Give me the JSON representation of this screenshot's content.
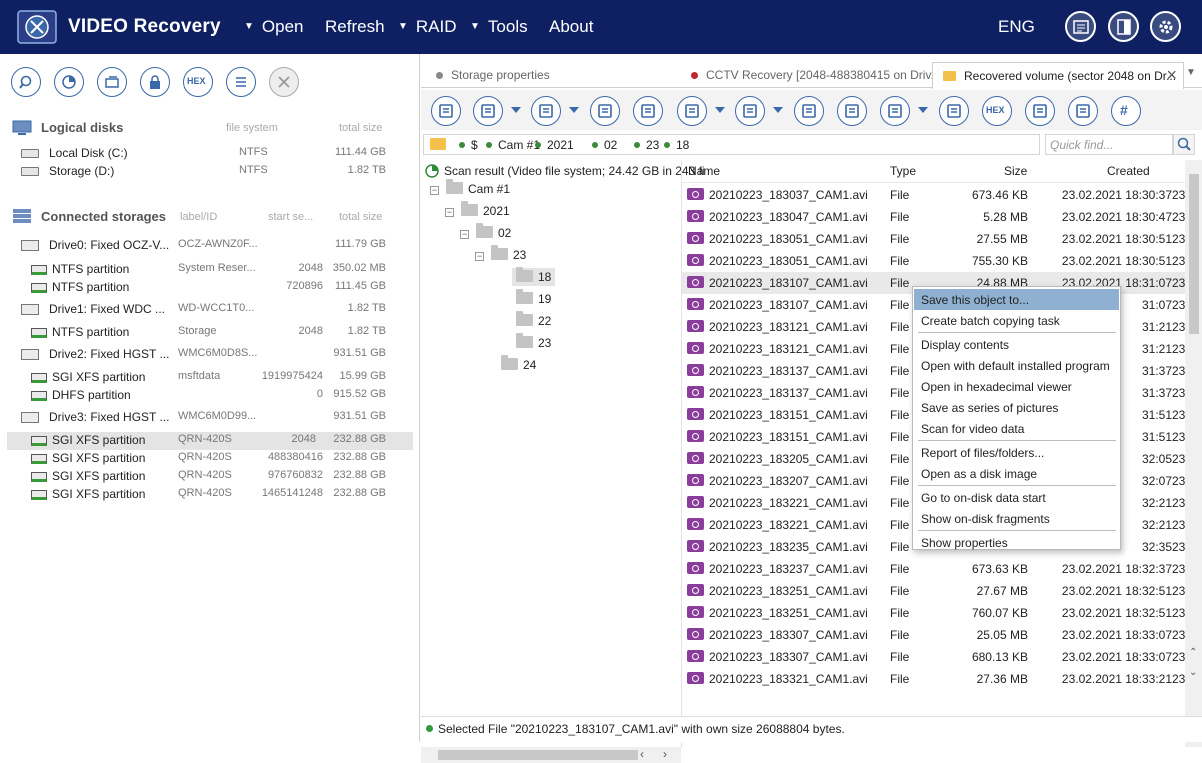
{
  "app": {
    "title": "VIDEO Recovery",
    "menu": [
      {
        "label": "Open",
        "arrow": true
      },
      {
        "label": "Refresh",
        "arrow": false
      },
      {
        "label": "RAID",
        "arrow": true
      },
      {
        "label": "Tools",
        "arrow": true
      },
      {
        "label": "About",
        "arrow": false
      }
    ],
    "arrow_glyph": "▼",
    "lang": "ENG",
    "header_icons": [
      "log-icon",
      "panel-toggle-icon",
      "settings-gear-icon"
    ]
  },
  "left_toolbar": [
    "search-icon",
    "scan-icon",
    "open-image-icon",
    "lock-icon",
    "hex-icon",
    "list-icon",
    "close-icon"
  ],
  "hex_label": "HEX",
  "logical": {
    "title": "Logical disks",
    "col_fs": "file system",
    "col_size": "total size",
    "items": [
      {
        "name": "Local Disk (C:)",
        "fs": "NTFS",
        "size": "111.44 GB"
      },
      {
        "name": "Storage (D:)",
        "fs": "NTFS",
        "size": "1.82 TB"
      }
    ]
  },
  "storages": {
    "title": "Connected storages",
    "col_label": "label/ID",
    "col_start": "start se...",
    "col_size": "total size",
    "items": [
      {
        "level": 0,
        "name": "Drive0: Fixed OCZ-V...",
        "label": "OCZ-AWNZ0F...",
        "start": "",
        "size": "111.79 GB",
        "selected": false
      },
      {
        "level": 1,
        "name": "NTFS partition",
        "label": "System Reser...",
        "start": "2048",
        "size": "350.02 MB",
        "selected": false
      },
      {
        "level": 1,
        "name": "NTFS partition",
        "label": "",
        "start": "720896",
        "size": "111.45 GB",
        "selected": false
      },
      {
        "level": 0,
        "name": "Drive1: Fixed WDC ...",
        "label": "WD-WCC1T0...",
        "start": "",
        "size": "1.82 TB",
        "selected": false
      },
      {
        "level": 1,
        "name": "NTFS partition",
        "label": "Storage",
        "start": "2048",
        "size": "1.82 TB",
        "selected": false
      },
      {
        "level": 0,
        "name": "Drive2: Fixed HGST ...",
        "label": "WMC6M0D8S...",
        "start": "",
        "size": "931.51 GB",
        "selected": false
      },
      {
        "level": 1,
        "name": "SGI XFS partition",
        "label": "msftdata",
        "start": "1919975424",
        "size": "15.99 GB",
        "selected": false
      },
      {
        "level": 1,
        "name": "DHFS partition",
        "label": "",
        "start": "0",
        "size": "915.52 GB",
        "selected": false
      },
      {
        "level": 0,
        "name": "Drive3: Fixed HGST ...",
        "label": "WMC6M0D99...",
        "start": "",
        "size": "931.51 GB",
        "selected": false
      },
      {
        "level": 1,
        "name": "SGI XFS partition",
        "label": "QRN-420S",
        "start": "2048",
        "size": "232.88 GB",
        "selected": true
      },
      {
        "level": 1,
        "name": "SGI XFS partition",
        "label": "QRN-420S",
        "start": "488380416",
        "size": "232.88 GB",
        "selected": false
      },
      {
        "level": 1,
        "name": "SGI XFS partition",
        "label": "QRN-420S",
        "start": "976760832",
        "size": "232.88 GB",
        "selected": false
      },
      {
        "level": 1,
        "name": "SGI XFS partition",
        "label": "QRN-420S",
        "start": "1465141248",
        "size": "232.88 GB",
        "selected": false
      }
    ]
  },
  "tabs": [
    {
      "label": "Storage properties",
      "dot": "#888888",
      "active": false
    },
    {
      "label": "CCTV Recovery [2048-488380415 on Driv...",
      "dot": "#c0262d",
      "active": false
    },
    {
      "label": "Recovered volume (sector 2048 on Dr...",
      "dot": "",
      "active": true
    }
  ],
  "tab_close": "×",
  "path": [
    "$",
    "Cam #1",
    "2021",
    "02",
    "23",
    "18"
  ],
  "quick_find": "Quick find...",
  "tree": {
    "root": "Scan result (Video file system; 24.42 GB in 243 fi",
    "nodes": [
      {
        "label": "Cam #1",
        "exp": "−"
      },
      {
        "label": "2021",
        "exp": "−"
      },
      {
        "label": "02",
        "exp": "−"
      },
      {
        "label": "23",
        "exp": "−"
      },
      {
        "label": "18",
        "exp": ""
      },
      {
        "label": "19",
        "exp": ""
      },
      {
        "label": "22",
        "exp": ""
      },
      {
        "label": "23",
        "exp": ""
      },
      {
        "label": "24",
        "exp": ""
      }
    ]
  },
  "files": {
    "cols": {
      "name": "Name",
      "type": "Type",
      "size": "Size",
      "created": "Created"
    },
    "rows": [
      {
        "name": "20210223_183037_CAM1.avi",
        "type": "File",
        "size": "673.46 KB",
        "created": "23.02.2021 18:30:37",
        "more": "23"
      },
      {
        "name": "20210223_183047_CAM1.avi",
        "type": "File",
        "size": "5.28 MB",
        "created": "23.02.2021 18:30:47",
        "more": "23"
      },
      {
        "name": "20210223_183051_CAM1.avi",
        "type": "File",
        "size": "27.55 MB",
        "created": "23.02.2021 18:30:51",
        "more": "23"
      },
      {
        "name": "20210223_183051_CAM1.avi",
        "type": "File",
        "size": "755.30 KB",
        "created": "23.02.2021 18:30:51",
        "more": "23"
      },
      {
        "name": "20210223_183107_CAM1.avi",
        "type": "File",
        "size": "24.88 MB",
        "created": "23.02.2021 18:31:07",
        "more": "23"
      },
      {
        "name": "20210223_183107_CAM1.avi",
        "type": "File",
        "size": "",
        "created": "31:07",
        "more": "23"
      },
      {
        "name": "20210223_183121_CAM1.avi",
        "type": "File",
        "size": "",
        "created": "31:21",
        "more": "23"
      },
      {
        "name": "20210223_183121_CAM1.avi",
        "type": "File",
        "size": "",
        "created": "31:21",
        "more": "23"
      },
      {
        "name": "20210223_183137_CAM1.avi",
        "type": "File",
        "size": "",
        "created": "31:37",
        "more": "23"
      },
      {
        "name": "20210223_183137_CAM1.avi",
        "type": "File",
        "size": "",
        "created": "31:37",
        "more": "23"
      },
      {
        "name": "20210223_183151_CAM1.avi",
        "type": "File",
        "size": "",
        "created": "31:51",
        "more": "23"
      },
      {
        "name": "20210223_183151_CAM1.avi",
        "type": "File",
        "size": "",
        "created": "31:51",
        "more": "23"
      },
      {
        "name": "20210223_183205_CAM1.avi",
        "type": "File",
        "size": "",
        "created": "32:05",
        "more": "23"
      },
      {
        "name": "20210223_183207_CAM1.avi",
        "type": "File",
        "size": "",
        "created": "32:07",
        "more": "23"
      },
      {
        "name": "20210223_183221_CAM1.avi",
        "type": "File",
        "size": "",
        "created": "32:21",
        "more": "23"
      },
      {
        "name": "20210223_183221_CAM1.avi",
        "type": "File",
        "size": "",
        "created": "32:21",
        "more": "23"
      },
      {
        "name": "20210223_183235_CAM1.avi",
        "type": "File",
        "size": "",
        "created": "32:35",
        "more": "23"
      },
      {
        "name": "20210223_183237_CAM1.avi",
        "type": "File",
        "size": "673.63 KB",
        "created": "23.02.2021 18:32:37",
        "more": "23"
      },
      {
        "name": "20210223_183251_CAM1.avi",
        "type": "File",
        "size": "27.67 MB",
        "created": "23.02.2021 18:32:51",
        "more": "23"
      },
      {
        "name": "20210223_183251_CAM1.avi",
        "type": "File",
        "size": "760.07 KB",
        "created": "23.02.2021 18:32:51",
        "more": "23"
      },
      {
        "name": "20210223_183307_CAM1.avi",
        "type": "File",
        "size": "25.05 MB",
        "created": "23.02.2021 18:33:07",
        "more": "23"
      },
      {
        "name": "20210223_183307_CAM1.avi",
        "type": "File",
        "size": "680.13 KB",
        "created": "23.02.2021 18:33:07",
        "more": "23"
      },
      {
        "name": "20210223_183321_CAM1.avi",
        "type": "File",
        "size": "27.36 MB",
        "created": "23.02.2021 18:33:21",
        "more": "23"
      }
    ]
  },
  "context_menu": [
    {
      "label": "Save this object to...",
      "highlight": true
    },
    {
      "label": "Create batch copying task"
    },
    {
      "sep": true
    },
    {
      "label": "Display contents"
    },
    {
      "label": "Open with default installed program"
    },
    {
      "label": "Open in hexadecimal viewer"
    },
    {
      "label": "Save as series of pictures"
    },
    {
      "label": "Scan for video data"
    },
    {
      "sep": true
    },
    {
      "label": "Report of files/folders..."
    },
    {
      "label": "Open as a disk image"
    },
    {
      "sep": true
    },
    {
      "label": "Go to on-disk data start"
    },
    {
      "label": "Show on-disk fragments"
    },
    {
      "sep": true
    },
    {
      "label": "Show properties"
    }
  ],
  "status": "Selected File \"20210223_183107_CAM1.avi\" with own size 26088804 bytes.",
  "colors": {
    "titlebar": "#0e2062",
    "accent": "#3b68a8",
    "status_dot": "#2e9a3c",
    "file_icon": "#8a3d9a"
  }
}
